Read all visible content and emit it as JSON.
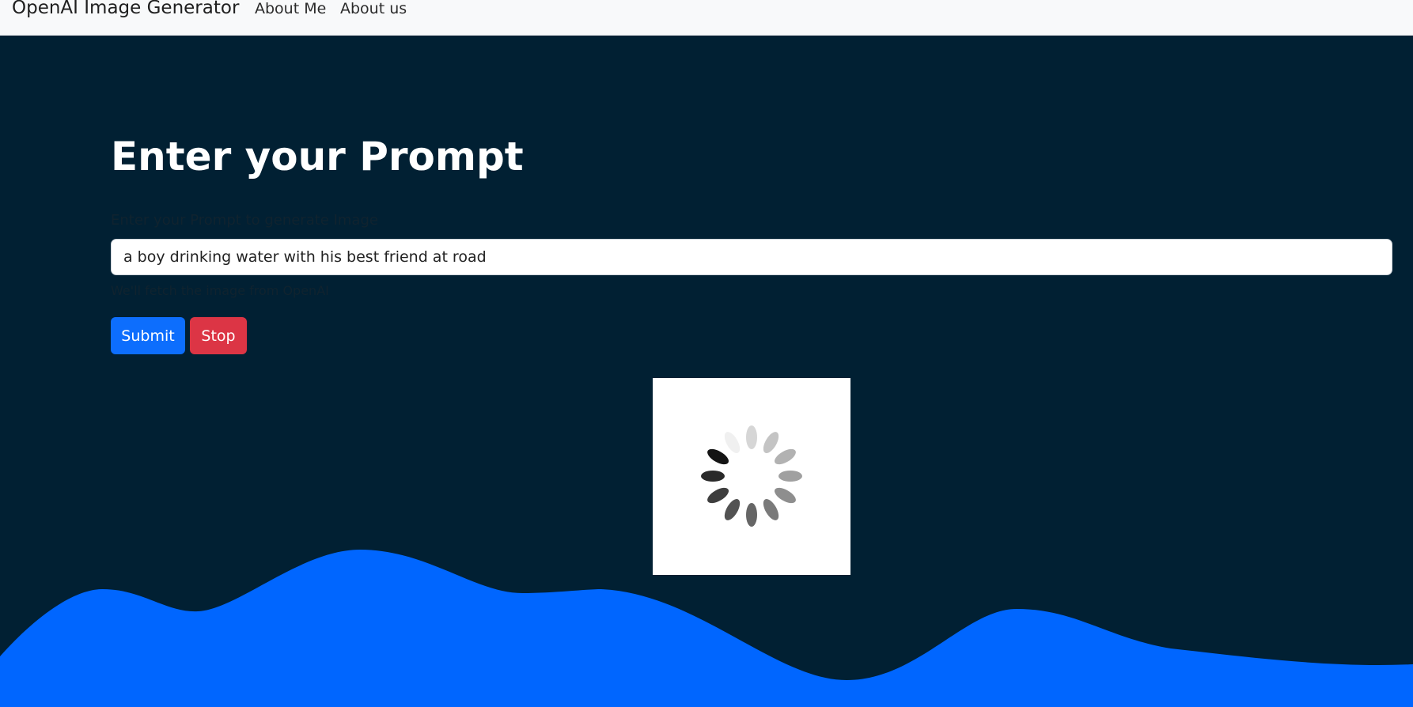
{
  "navbar": {
    "brand": "OpenAI Image Generator",
    "links": [
      "About Me",
      "About us"
    ]
  },
  "main": {
    "heading": "Enter your Prompt",
    "input_label": "Enter your Prompt to generate Image",
    "prompt_value": "a boy drinking water with his best friend at road",
    "help_text": "We'll fetch the image from OpenAI",
    "submit_label": "Submit",
    "stop_label": "Stop"
  },
  "icons": {
    "loading": "loading-spinner-icon"
  },
  "colors": {
    "background": "#012033",
    "wave": "#0066ff",
    "submit": "#0d6efd",
    "stop": "#dc3545",
    "navbar": "#f8f9fa"
  }
}
